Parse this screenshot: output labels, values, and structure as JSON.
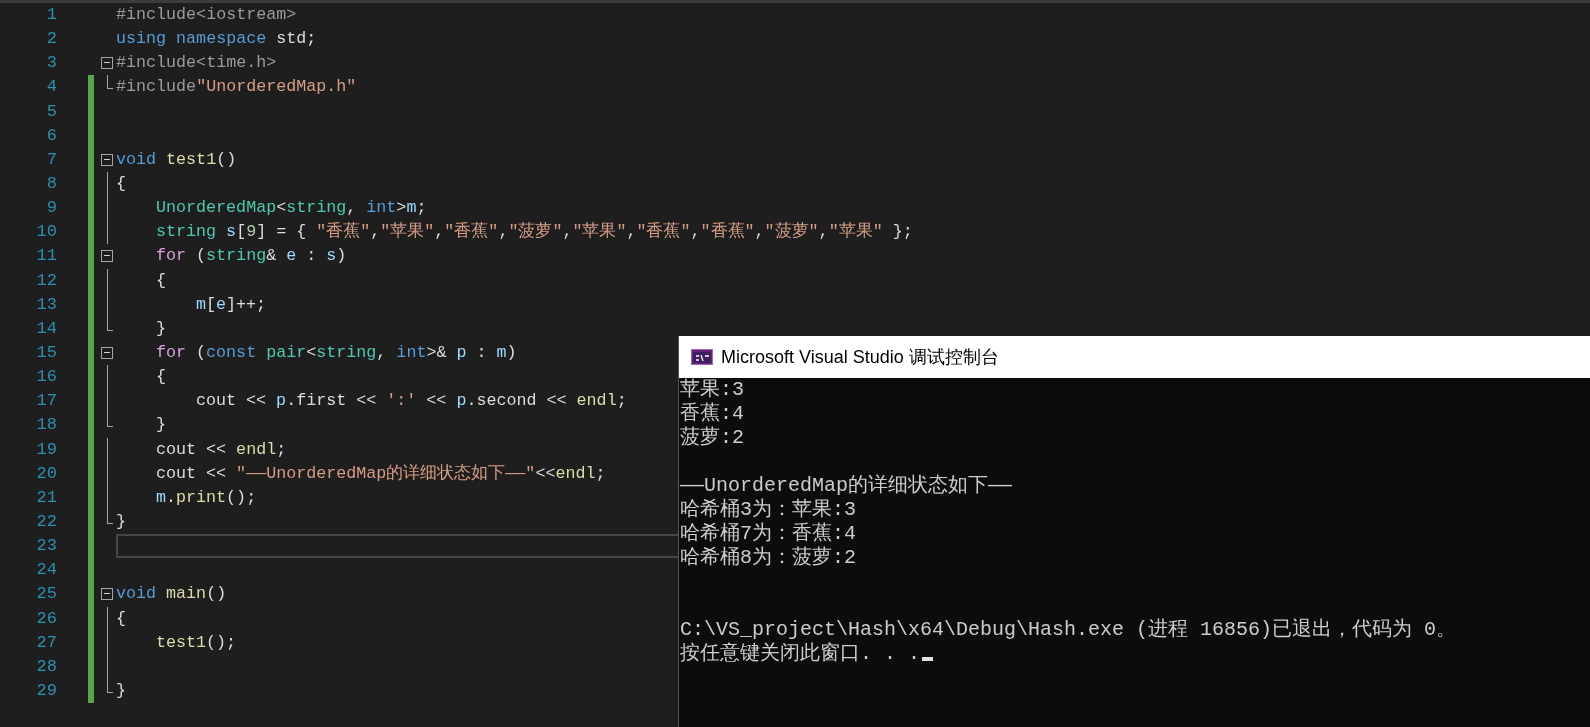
{
  "editor": {
    "lines": [
      {
        "number": "1",
        "kind": "top",
        "modified": false,
        "collapsible": false,
        "fold_end": false,
        "current": false,
        "tokens": [
          {
            "kind": "pre",
            "text": "#include<iostream>"
          }
        ]
      },
      {
        "number": "2",
        "kind": "top",
        "modified": false,
        "collapsible": false,
        "fold_end": false,
        "current": false,
        "tokens": [
          {
            "kind": "kw",
            "text": "using namespace"
          },
          {
            "kind": "plain",
            "text": " std;"
          }
        ]
      },
      {
        "number": "3",
        "kind": "top",
        "modified": false,
        "collapsible": true,
        "fold_end": false,
        "current": false,
        "tokens": [
          {
            "kind": "pre",
            "text": "#include<time.h>"
          }
        ]
      },
      {
        "number": "4",
        "kind": "top",
        "modified": true,
        "collapsible": false,
        "fold_end": true,
        "current": false,
        "tokens": [
          {
            "kind": "pre",
            "text": "#include"
          },
          {
            "kind": "str",
            "text": "\"UnorderedMap.h\""
          }
        ]
      },
      {
        "number": "5",
        "kind": "top",
        "modified": true,
        "collapsible": false,
        "fold_end": false,
        "current": false
      },
      {
        "number": "6",
        "kind": "top",
        "modified": true,
        "collapsible": false,
        "fold_end": false,
        "current": false
      },
      {
        "number": "7",
        "kind": "top",
        "modified": true,
        "collapsible": true,
        "fold_end": false,
        "current": false,
        "tokens": [
          {
            "kind": "kw",
            "text": "void"
          },
          {
            "kind": "fn",
            "text": " test1"
          },
          {
            "kind": "plain",
            "text": "()"
          }
        ]
      },
      {
        "number": "8",
        "kind": "top",
        "modified": true,
        "collapsible": false,
        "fold_end": false,
        "current": false,
        "tokens": [
          {
            "kind": "plain",
            "text": "{"
          }
        ]
      },
      {
        "number": "9",
        "kind": "inner",
        "modified": true,
        "collapsible": false,
        "fold_end": false,
        "current": false,
        "tokens": [
          {
            "kind": "type",
            "text": "UnorderedMap"
          },
          {
            "kind": "plain",
            "text": "<"
          },
          {
            "kind": "type",
            "text": "string"
          },
          {
            "kind": "plain",
            "text": ","
          },
          {
            "kind": "kw",
            "text": " int"
          },
          {
            "kind": "plain",
            "text": ">"
          },
          {
            "kind": "var",
            "text": "m"
          },
          {
            "kind": "plain",
            "text": ";"
          }
        ]
      },
      {
        "number": "10",
        "kind": "inner",
        "modified": true,
        "collapsible": false,
        "fold_end": false,
        "current": false,
        "tokens": [
          {
            "kind": "type",
            "text": "string"
          },
          {
            "kind": "var",
            "text": " s"
          },
          {
            "kind": "plain",
            "text": "["
          },
          {
            "kind": "num",
            "text": "9"
          },
          {
            "kind": "plain",
            "text": "] = {"
          },
          {
            "kind": "str",
            "text": " \"香蕉\""
          },
          {
            "kind": "plain",
            "text": ","
          },
          {
            "kind": "str",
            "text": "\"苹果\""
          },
          {
            "kind": "plain",
            "text": ","
          },
          {
            "kind": "str",
            "text": "\"香蕉\""
          },
          {
            "kind": "plain",
            "text": ","
          },
          {
            "kind": "str",
            "text": "\"菠萝\""
          },
          {
            "kind": "plain",
            "text": ","
          },
          {
            "kind": "str",
            "text": "\"苹果\""
          },
          {
            "kind": "plain",
            "text": ","
          },
          {
            "kind": "str",
            "text": "\"香蕉\""
          },
          {
            "kind": "plain",
            "text": ","
          },
          {
            "kind": "str",
            "text": "\"香蕉\""
          },
          {
            "kind": "plain",
            "text": ","
          },
          {
            "kind": "str",
            "text": "\"菠萝\""
          },
          {
            "kind": "plain",
            "text": ","
          },
          {
            "kind": "str",
            "text": "\"苹果\""
          },
          {
            "kind": "plain",
            "text": " };"
          }
        ]
      },
      {
        "number": "11",
        "kind": "inner",
        "modified": true,
        "collapsible": true,
        "fold_end": false,
        "current": false,
        "tokens": [
          {
            "kind": "ctl",
            "text": "for"
          },
          {
            "kind": "plain",
            "text": " ("
          },
          {
            "kind": "type",
            "text": "string"
          },
          {
            "kind": "plain",
            "text": "&"
          },
          {
            "kind": "var",
            "text": " e"
          },
          {
            "kind": "plain",
            "text": " :"
          },
          {
            "kind": "var",
            "text": " s"
          },
          {
            "kind": "plain",
            "text": ")"
          }
        ]
      },
      {
        "number": "12",
        "kind": "inner",
        "modified": true,
        "collapsible": false,
        "fold_end": false,
        "current": false,
        "tokens": [
          {
            "kind": "plain",
            "text": "{"
          }
        ]
      },
      {
        "number": "13",
        "kind": "deep",
        "modified": true,
        "collapsible": false,
        "fold_end": false,
        "current": false,
        "tokens": [
          {
            "kind": "var",
            "text": "m"
          },
          {
            "kind": "plain",
            "text": "["
          },
          {
            "kind": "var",
            "text": "e"
          },
          {
            "kind": "plain",
            "text": "]++;"
          }
        ]
      },
      {
        "number": "14",
        "kind": "inner",
        "modified": true,
        "collapsible": false,
        "fold_end": true,
        "current": false,
        "tokens": [
          {
            "kind": "plain",
            "text": "}"
          }
        ]
      },
      {
        "number": "15",
        "kind": "inner",
        "modified": true,
        "collapsible": true,
        "fold_end": false,
        "current": false,
        "tokens": [
          {
            "kind": "ctl",
            "text": "for"
          },
          {
            "kind": "plain",
            "text": " ("
          },
          {
            "kind": "kw",
            "text": "const"
          },
          {
            "kind": "type",
            "text": " pair"
          },
          {
            "kind": "plain",
            "text": "<"
          },
          {
            "kind": "type",
            "text": "string"
          },
          {
            "kind": "plain",
            "text": ","
          },
          {
            "kind": "kw",
            "text": " int"
          },
          {
            "kind": "plain",
            "text": ">&"
          },
          {
            "kind": "var",
            "text": " p"
          },
          {
            "kind": "plain",
            "text": " :"
          },
          {
            "kind": "var",
            "text": " m"
          },
          {
            "kind": "plain",
            "text": ")"
          }
        ]
      },
      {
        "number": "16",
        "kind": "inner",
        "modified": true,
        "collapsible": false,
        "fold_end": false,
        "current": false,
        "tokens": [
          {
            "kind": "plain",
            "text": "{"
          }
        ]
      },
      {
        "number": "17",
        "kind": "deep",
        "modified": true,
        "collapsible": false,
        "fold_end": false,
        "current": false,
        "tokens": [
          {
            "kind": "plain",
            "text": "cout <<"
          },
          {
            "kind": "var",
            "text": " p"
          },
          {
            "kind": "plain",
            "text": ".first <<"
          },
          {
            "kind": "str",
            "text": " ':'"
          },
          {
            "kind": "plain",
            "text": " <<"
          },
          {
            "kind": "var",
            "text": " p"
          },
          {
            "kind": "plain",
            "text": ".second <<"
          },
          {
            "kind": "fn",
            "text": " endl"
          },
          {
            "kind": "plain",
            "text": ";"
          }
        ]
      },
      {
        "number": "18",
        "kind": "inner",
        "modified": true,
        "collapsible": false,
        "fold_end": true,
        "current": false,
        "tokens": [
          {
            "kind": "plain",
            "text": "}"
          }
        ]
      },
      {
        "number": "19",
        "kind": "inner",
        "modified": true,
        "collapsible": false,
        "fold_end": false,
        "current": false,
        "tokens": [
          {
            "kind": "plain",
            "text": "cout <<"
          },
          {
            "kind": "fn",
            "text": " endl"
          },
          {
            "kind": "plain",
            "text": ";"
          }
        ]
      },
      {
        "number": "20",
        "kind": "inner",
        "modified": true,
        "collapsible": false,
        "fold_end": false,
        "current": false,
        "tokens": [
          {
            "kind": "plain",
            "text": "cout <<"
          },
          {
            "kind": "str",
            "text": " \"——UnorderedMap的详细状态如下——\""
          },
          {
            "kind": "plain",
            "text": "<<"
          },
          {
            "kind": "fn",
            "text": "endl"
          },
          {
            "kind": "plain",
            "text": ";"
          }
        ]
      },
      {
        "number": "21",
        "kind": "inner",
        "modified": true,
        "collapsible": false,
        "fold_end": false,
        "current": false,
        "tokens": [
          {
            "kind": "var",
            "text": "m"
          },
          {
            "kind": "plain",
            "text": "."
          },
          {
            "kind": "fn",
            "text": "print"
          },
          {
            "kind": "plain",
            "text": "();"
          }
        ]
      },
      {
        "number": "22",
        "kind": "top",
        "modified": true,
        "collapsible": false,
        "fold_end": true,
        "current": false,
        "tokens": [
          {
            "kind": "plain",
            "text": "}"
          }
        ]
      },
      {
        "number": "23",
        "kind": "top",
        "modified": true,
        "collapsible": false,
        "fold_end": false,
        "current": true
      },
      {
        "number": "24",
        "kind": "top",
        "modified": true,
        "collapsible": false,
        "fold_end": false,
        "current": false
      },
      {
        "number": "25",
        "kind": "top",
        "modified": true,
        "collapsible": true,
        "fold_end": false,
        "current": false,
        "tokens": [
          {
            "kind": "kw",
            "text": "void"
          },
          {
            "kind": "fn",
            "text": " main"
          },
          {
            "kind": "plain",
            "text": "()"
          }
        ]
      },
      {
        "number": "26",
        "kind": "top",
        "modified": true,
        "collapsible": false,
        "fold_end": false,
        "current": false,
        "tokens": [
          {
            "kind": "plain",
            "text": "{"
          }
        ]
      },
      {
        "number": "27",
        "kind": "inner",
        "modified": true,
        "collapsible": false,
        "fold_end": false,
        "current": false,
        "tokens": [
          {
            "kind": "fn",
            "text": "test1"
          },
          {
            "kind": "plain",
            "text": "();"
          }
        ]
      },
      {
        "number": "28",
        "kind": "top",
        "modified": true,
        "collapsible": false,
        "fold_end": false,
        "current": false
      },
      {
        "number": "29",
        "kind": "top",
        "modified": true,
        "collapsible": false,
        "fold_end": true,
        "current": false,
        "tokens": [
          {
            "kind": "plain",
            "text": "}"
          }
        ]
      }
    ]
  },
  "console": {
    "title": "Microsoft Visual Studio 调试控制台",
    "output_groups": [
      {
        "lines": [
          "苹果:3",
          "香蕉:4",
          "菠萝:2"
        ],
        "cursor": false
      },
      {
        "lines": [
          "——UnorderedMap的详细状态如下——",
          "哈希桶3为：苹果:3",
          "哈希桶7为：香蕉:4",
          "哈希桶8为：菠萝:2"
        ],
        "cursor": false
      },
      {
        "lines": [
          "C:\\VS_project\\Hash\\x64\\Debug\\Hash.exe (进程 16856)已退出，代码为 0。",
          "按任意键关闭此窗口. . ."
        ],
        "cursor": true
      }
    ]
  }
}
